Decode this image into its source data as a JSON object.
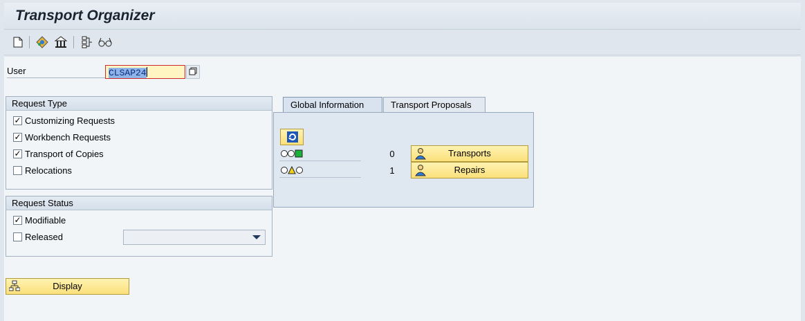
{
  "title": "Transport Organizer",
  "toolbar": {
    "icons": [
      "new-document-icon",
      "objects-icon",
      "organizer-icon",
      "structure-icon",
      "glasses-icon"
    ]
  },
  "user": {
    "label": "User",
    "value": "CLSAP24"
  },
  "request_type": {
    "heading": "Request Type",
    "options": [
      {
        "label": "Customizing Requests",
        "checked": true
      },
      {
        "label": "Workbench Requests",
        "checked": true
      },
      {
        "label": "Transport of Copies",
        "checked": true
      },
      {
        "label": "Relocations",
        "checked": false
      }
    ]
  },
  "request_status": {
    "heading": "Request Status",
    "options": [
      {
        "label": "Modifiable",
        "checked": true
      },
      {
        "label": "Released",
        "checked": false
      }
    ],
    "released_dropdown_value": ""
  },
  "display_button": "Display",
  "tabs": [
    {
      "label": "Global Information",
      "active": true
    },
    {
      "label": "Transport Proposals",
      "active": false
    }
  ],
  "global_info": {
    "rows": [
      {
        "status": "green",
        "count": "0",
        "button": "Transports"
      },
      {
        "status": "yellow",
        "count": "1",
        "button": "Repairs"
      }
    ]
  },
  "colors": {
    "accent_yellow": "#fbe07a",
    "light_green": "#19b33a",
    "light_yellow": "#f3d21a"
  }
}
